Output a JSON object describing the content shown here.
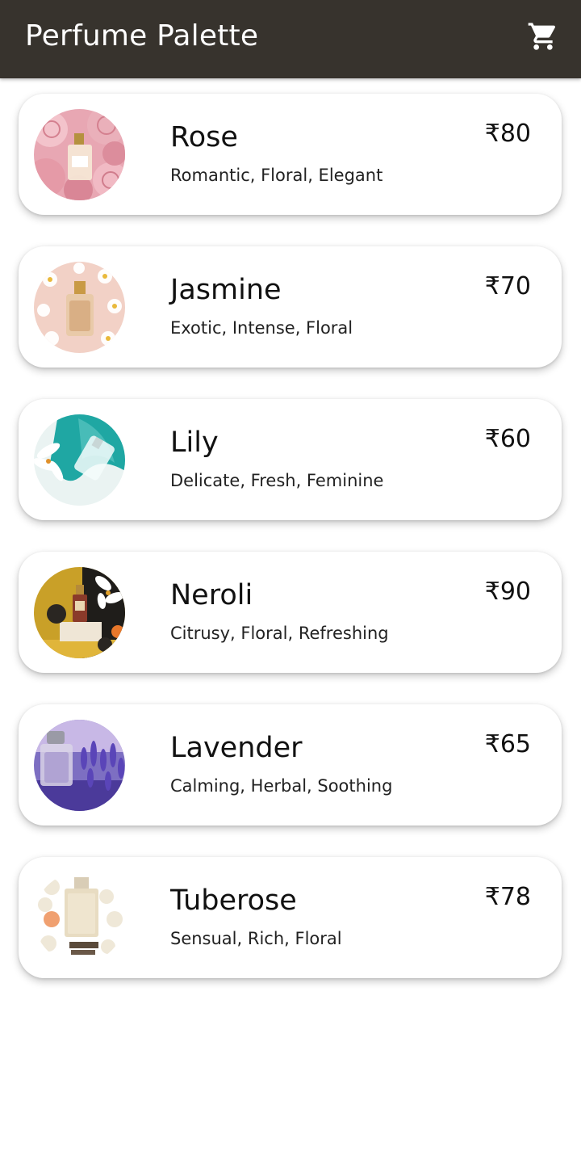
{
  "app_bar": {
    "title": "Perfume Palette",
    "cart_icon": "shopping-cart-icon"
  },
  "products": [
    {
      "name": "Rose",
      "description": "Romantic, Floral, Elegant",
      "price": "₹80"
    },
    {
      "name": "Jasmine",
      "description": "Exotic, Intense, Floral",
      "price": "₹70"
    },
    {
      "name": "Lily",
      "description": "Delicate, Fresh, Feminine",
      "price": "₹60"
    },
    {
      "name": "Neroli",
      "description": "Citrusy, Floral, Refreshing",
      "price": "₹90"
    },
    {
      "name": "Lavender",
      "description": "Calming, Herbal, Soothing",
      "price": "₹65"
    },
    {
      "name": "Tuberose",
      "description": "Sensual, Rich, Floral",
      "price": "₹78"
    }
  ],
  "colors": {
    "app_bar": "#37332d",
    "card_background": "#ffffff",
    "text": "#111111"
  }
}
